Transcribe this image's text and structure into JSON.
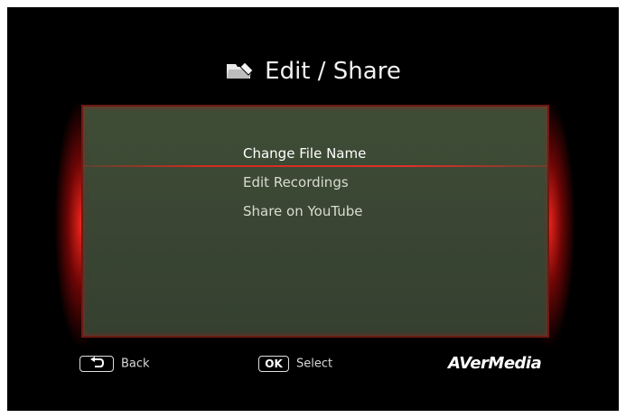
{
  "title": "Edit / Share",
  "menu": {
    "items": [
      {
        "label": "Change File Name",
        "selected": true
      },
      {
        "label": "Edit Recordings",
        "selected": false
      },
      {
        "label": "Share on YouTube",
        "selected": false
      }
    ]
  },
  "footer": {
    "back_label": "Back",
    "ok_key": "OK",
    "select_label": "Select",
    "brand": "AVerMedia"
  },
  "icons": {
    "title_icon": "folder-edit-icon",
    "back_key_icon": "return-arrow-icon"
  },
  "colors": {
    "background": "#000000",
    "panel": "#3c4934",
    "highlight": "#d22a1f",
    "glow": "#ff2a1e"
  }
}
